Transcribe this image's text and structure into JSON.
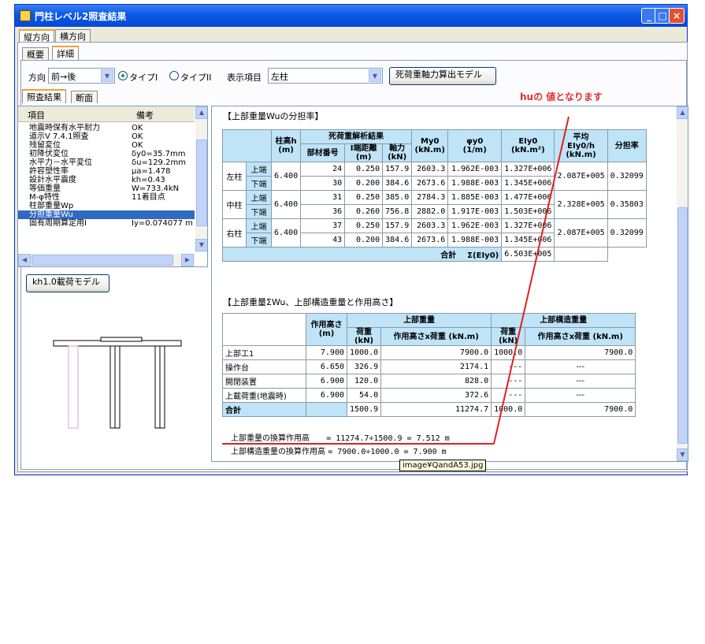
{
  "window": {
    "title": "門柱レベル2照査結果"
  },
  "main_tabs": [
    "縦方向",
    "横方向"
  ],
  "sub_tabs": [
    "概要",
    "詳細"
  ],
  "toolbar": {
    "direction_label": "方向",
    "direction_value": "前→後",
    "radio_type1": "タイプI",
    "radio_type2": "タイプII",
    "display_label": "表示項目",
    "display_value": "左柱",
    "dead_load_button": "死荷重軸力算出モデル"
  },
  "inner_tabs": [
    "照査結果",
    "断面"
  ],
  "item_list": {
    "headers": [
      "項目",
      "備考"
    ],
    "rows": [
      [
        "地震時保有水平耐力",
        "OK"
      ],
      [
        "道示V 7.4.1照査",
        "OK"
      ],
      [
        "残留変位",
        "OK"
      ],
      [
        "初降伏変位",
        "δy0=35.7mm"
      ],
      [
        "水平力－水平変位",
        "δu=129.2mm"
      ],
      [
        "許容塑性率",
        "μa=1.478"
      ],
      [
        "設計水平震度",
        "kh=0.43"
      ],
      [
        "等価重量",
        "W=733.4kN"
      ],
      [
        "M-φ特性",
        "11着目点"
      ],
      [
        "柱部重量Wp",
        ""
      ],
      [
        "分担重量Wu",
        ""
      ],
      [
        "固有周期算定用I",
        "Iy=0.074077 m"
      ]
    ],
    "selected_index": 10
  },
  "kh_button": "kh1.0載荷モデル",
  "annotation": "huの 値となります",
  "section1": {
    "title": "【上部重量Wuの分担率】",
    "headers": {
      "height": "柱高h\n(m)",
      "analysis": "死荷重解析結果",
      "member": "部材番号",
      "i_dist": "I端距離\n(m)",
      "axial": "軸力\n(kN)",
      "my0": "My0\n(kN.m)",
      "phi": "φy0\n(1/m)",
      "ei": "EIy0\n(kN.m²)",
      "avg": "平均\nEIy0/h\n(kN.m)",
      "ratio": "分担率"
    },
    "rows": [
      {
        "col": "左柱",
        "pos": "上端",
        "h": "6.400",
        "member": "24",
        "idist": "0.250",
        "axial": "157.9",
        "my0": "2603.3",
        "phi": "1.962E-003",
        "ei": "1.327E+006",
        "avg": "2.087E+005",
        "ratio": "0.32099"
      },
      {
        "col": "",
        "pos": "下端",
        "h": "",
        "member": "30",
        "idist": "0.200",
        "axial": "384.6",
        "my0": "2673.6",
        "phi": "1.988E-003",
        "ei": "1.345E+006",
        "avg": "",
        "ratio": ""
      },
      {
        "col": "中柱",
        "pos": "上端",
        "h": "6.400",
        "member": "31",
        "idist": "0.250",
        "axial": "385.0",
        "my0": "2784.3",
        "phi": "1.885E-003",
        "ei": "1.477E+006",
        "avg": "2.328E+005",
        "ratio": "0.35803"
      },
      {
        "col": "",
        "pos": "下端",
        "h": "",
        "member": "36",
        "idist": "0.260",
        "axial": "756.8",
        "my0": "2882.0",
        "phi": "1.917E-003",
        "ei": "1.503E+006",
        "avg": "",
        "ratio": ""
      },
      {
        "col": "右柱",
        "pos": "上端",
        "h": "6.400",
        "member": "37",
        "idist": "0.250",
        "axial": "157.9",
        "my0": "2603.3",
        "phi": "1.962E-003",
        "ei": "1.327E+006",
        "avg": "2.087E+005",
        "ratio": "0.32099"
      },
      {
        "col": "",
        "pos": "下端",
        "h": "",
        "member": "43",
        "idist": "0.200",
        "axial": "384.6",
        "my0": "2673.6",
        "phi": "1.988E-003",
        "ei": "1.345E+006",
        "avg": "",
        "ratio": ""
      }
    ],
    "total_label": "合計",
    "total_sigma": "Σ(EIy0)",
    "total_value": "6.503E+005"
  },
  "section2": {
    "title": "【上部重量ΣWu、上部構造重量と作用高さ】",
    "headers": {
      "height": "作用高さ\n(m)",
      "upper": "上部重量",
      "struct": "上部構造重量",
      "load": "荷重\n(kN)",
      "hxload": "作用高さx荷重 (kN.m)",
      "load2": "荷重\n(kN)",
      "hxload2": "作用高さx荷重 (kN.m)"
    },
    "rows": [
      {
        "name": "上部工1",
        "h": "7.900",
        "load": "1000.0",
        "hx": "7900.0",
        "load2": "1000.0",
        "hx2": "7900.0"
      },
      {
        "name": "操作台",
        "h": "6.650",
        "load": "326.9",
        "hx": "2174.1",
        "load2": "---",
        "hx2": "---"
      },
      {
        "name": "開閉装置",
        "h": "6.900",
        "load": "120.0",
        "hx": "828.0",
        "load2": "---",
        "hx2": "---"
      },
      {
        "name": "上載荷重(地震時)",
        "h": "6.900",
        "load": "54.0",
        "hx": "372.6",
        "load2": "---",
        "hx2": "---"
      },
      {
        "name": "合計",
        "h": "",
        "load": "1500.9",
        "hx": "11274.7",
        "load2": "1000.0",
        "hx2": "7900.0"
      }
    ],
    "formula1_label": "上部重量の換算作用高",
    "formula1_value": "= 11274.7÷1500.9 = 7.512 m",
    "formula2_label": "上部構造重量の換算作用高",
    "formula2_value": "= 7900.0÷1000.0 = 7.900 m"
  },
  "tooltip": "image¥QandA53.jpg",
  "colors": {
    "title_bar": "#0a58e6",
    "header_cell": "#bfe3f7",
    "annotation": "#e03030",
    "selected_row": "#316ac5"
  }
}
